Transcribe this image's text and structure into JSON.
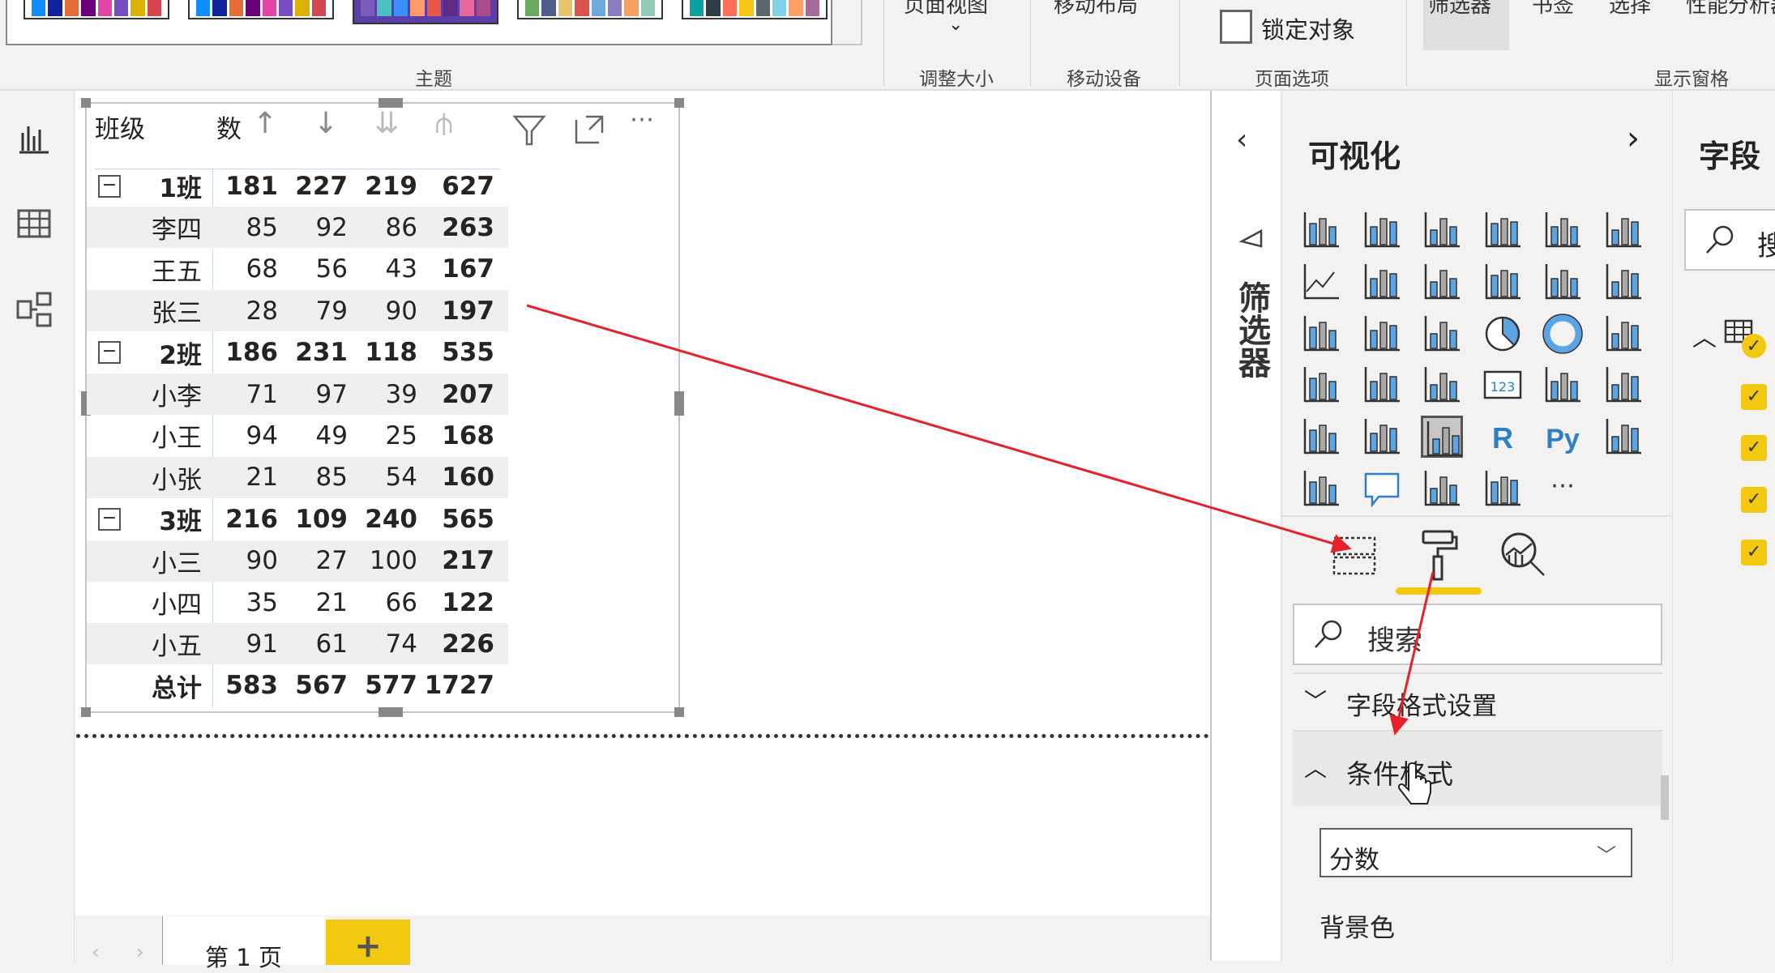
{
  "ribbon": {
    "theme_group_label": "主题",
    "themes": [
      {
        "colors": [
          "#118dff",
          "#12239e",
          "#e66c37",
          "#6b007b",
          "#e044a7",
          "#744ec2",
          "#d9b300",
          "#d64550"
        ]
      },
      {
        "colors": [
          "#118dff",
          "#12239e",
          "#e66c37",
          "#6b007b",
          "#e044a7",
          "#744ec2",
          "#d9b300",
          "#d64550"
        ]
      },
      {
        "colors": [
          "#7b5cb8",
          "#4bbfc4",
          "#3d8fff",
          "#ff9a6a",
          "#e8584a",
          "#5e2a86",
          "#e8679e",
          "#a84b8a"
        ],
        "selected": true
      },
      {
        "colors": [
          "#6aa964",
          "#4e5d8c",
          "#e9c46a",
          "#d9534f",
          "#6fa8dc",
          "#8e7cc3",
          "#f4a261",
          "#90cdb8"
        ]
      },
      {
        "colors": [
          "#0aa1a0",
          "#2f3e46",
          "#ff6f59",
          "#f5c518",
          "#5c6770",
          "#7fd3e8",
          "#ff9f68",
          "#a56b9a"
        ]
      }
    ],
    "page_view_label": "页面视图",
    "resize_group_label": "调整大小",
    "mobile_layout_label": "移动布局",
    "mobile_group_label": "移动设备",
    "lock_objects_label": "锁定对象",
    "lock_objects_checked": false,
    "page_options_group_label": "页面选项",
    "show_panes": [
      "筛选器",
      "书签",
      "选择",
      "性能分析器"
    ],
    "show_panes_group_label": "显示窗格"
  },
  "left_nav": [
    "report-view-icon",
    "data-view-icon",
    "model-view-icon"
  ],
  "matrix": {
    "headers": {
      "row": "班级",
      "value": "数"
    },
    "groups": [
      {
        "name": "1班",
        "totals": [
          "181",
          "227",
          "219",
          "627"
        ],
        "rows": [
          {
            "name": "李四",
            "values": [
              "85",
              "92",
              "86",
              "263"
            ]
          },
          {
            "name": "王五",
            "values": [
              "68",
              "56",
              "43",
              "167"
            ]
          },
          {
            "name": "张三",
            "values": [
              "28",
              "79",
              "90",
              "197"
            ]
          }
        ]
      },
      {
        "name": "2班",
        "totals": [
          "186",
          "231",
          "118",
          "535"
        ],
        "rows": [
          {
            "name": "小李",
            "values": [
              "71",
              "97",
              "39",
              "207"
            ]
          },
          {
            "name": "小王",
            "values": [
              "94",
              "49",
              "25",
              "168"
            ]
          },
          {
            "name": "小张",
            "values": [
              "21",
              "85",
              "54",
              "160"
            ]
          }
        ]
      },
      {
        "name": "3班",
        "totals": [
          "216",
          "109",
          "240",
          "565"
        ],
        "rows": [
          {
            "name": "小三",
            "values": [
              "90",
              "27",
              "100",
              "217"
            ]
          },
          {
            "name": "小四",
            "values": [
              "35",
              "21",
              "66",
              "122"
            ]
          },
          {
            "name": "小五",
            "values": [
              "91",
              "61",
              "74",
              "226"
            ]
          }
        ]
      }
    ],
    "grand_total": {
      "name": "总计",
      "values": [
        "583",
        "567",
        "577",
        "1727"
      ]
    },
    "expand_symbol": "⊟"
  },
  "page_tabs": {
    "tabs": [
      "第 1 页"
    ],
    "add_label": "+"
  },
  "filter_pane": {
    "label": "筛选器"
  },
  "viz_pane": {
    "title": "可视化",
    "icons": [
      "stacked-bar",
      "stacked-column",
      "clustered-bar",
      "clustered-column",
      "100-stacked-bar",
      "100-stacked-column",
      "line",
      "area",
      "stacked-area",
      "line-clustered-column",
      "line-stacked-column",
      "ribbon",
      "waterfall",
      "funnel",
      "scatter",
      "pie",
      "donut",
      "treemap",
      "map",
      "filled-map",
      "gauge",
      "card",
      "multi-row-card",
      "kpi",
      "slicer",
      "table",
      "matrix",
      "r-visual",
      "python-visual",
      "key-influencers",
      "decomposition-tree",
      "qa",
      "arcgis-map",
      "power-apps",
      "more"
    ],
    "selected_icon": "matrix",
    "tabs": [
      "fields-tab",
      "format-tab",
      "analytics-tab"
    ],
    "active_tab": "format-tab",
    "search_placeholder": "搜索",
    "sections": [
      {
        "label": "字段格式设置",
        "expanded": false
      },
      {
        "label": "条件格式",
        "expanded": true
      }
    ],
    "cf_field": "分数",
    "background_color_label": "背景色",
    "accent": "#f2c811"
  },
  "fields_pane": {
    "title": "字段",
    "search_placeholder": "搜",
    "checked_count": 5
  }
}
